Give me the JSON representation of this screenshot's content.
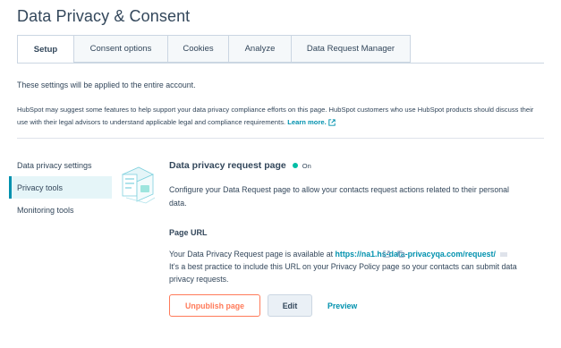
{
  "page": {
    "title": "Data Privacy & Consent"
  },
  "tabs": [
    {
      "label": "Setup"
    },
    {
      "label": "Consent options"
    },
    {
      "label": "Cookies"
    },
    {
      "label": "Analyze"
    },
    {
      "label": "Data Request Manager"
    }
  ],
  "intro": {
    "account_note": "These settings will be applied to the entire account.",
    "disclaimer": "HubSpot may suggest some features to help support your data privacy compliance efforts on this page. HubSpot customers who use HubSpot products should discuss their use with their legal advisors to understand applicable legal and compliance requirements.",
    "learn_more": "Learn more."
  },
  "sidebar": {
    "items": [
      {
        "label": "Data privacy settings"
      },
      {
        "label": "Privacy tools"
      },
      {
        "label": "Monitoring tools"
      }
    ]
  },
  "main": {
    "heading": "Data privacy request page",
    "status": "On",
    "status_color": "#00bda5",
    "description": "Configure your Data Request page to allow your contacts request actions related to their personal data.",
    "page_url_heading": "Page URL",
    "url_prefix": "Your Data Privacy Request page is available at",
    "url": "https://na1.hs-data-privacyqa.com/request/",
    "tip": "It's a best practice to include this URL on your Privacy Policy page so your contacts can submit data privacy requests.",
    "buttons": {
      "unpublish": "Unpublish page",
      "edit": "Edit",
      "preview": "Preview"
    }
  },
  "colors": {
    "accent": "#0091ae",
    "unpublish": "#ff7a59",
    "text": "#33475b"
  }
}
